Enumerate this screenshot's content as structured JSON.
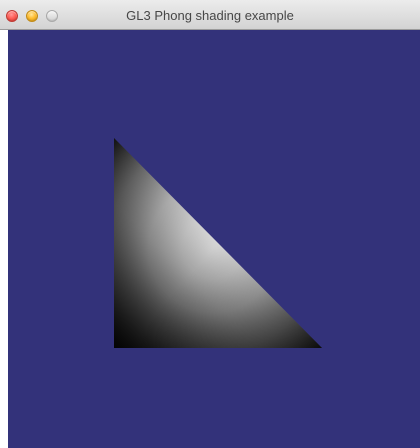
{
  "window": {
    "title": "GL3 Phong shading example",
    "buttons": {
      "close": "close-button",
      "minimize": "minimize-button",
      "zoom": "zoom-button"
    }
  },
  "canvas": {
    "background_color": "#33327a",
    "shape": {
      "type": "triangle",
      "shading": "phong",
      "colors": [
        "#000000",
        "#ffffff",
        "#5a5a5a"
      ]
    }
  }
}
